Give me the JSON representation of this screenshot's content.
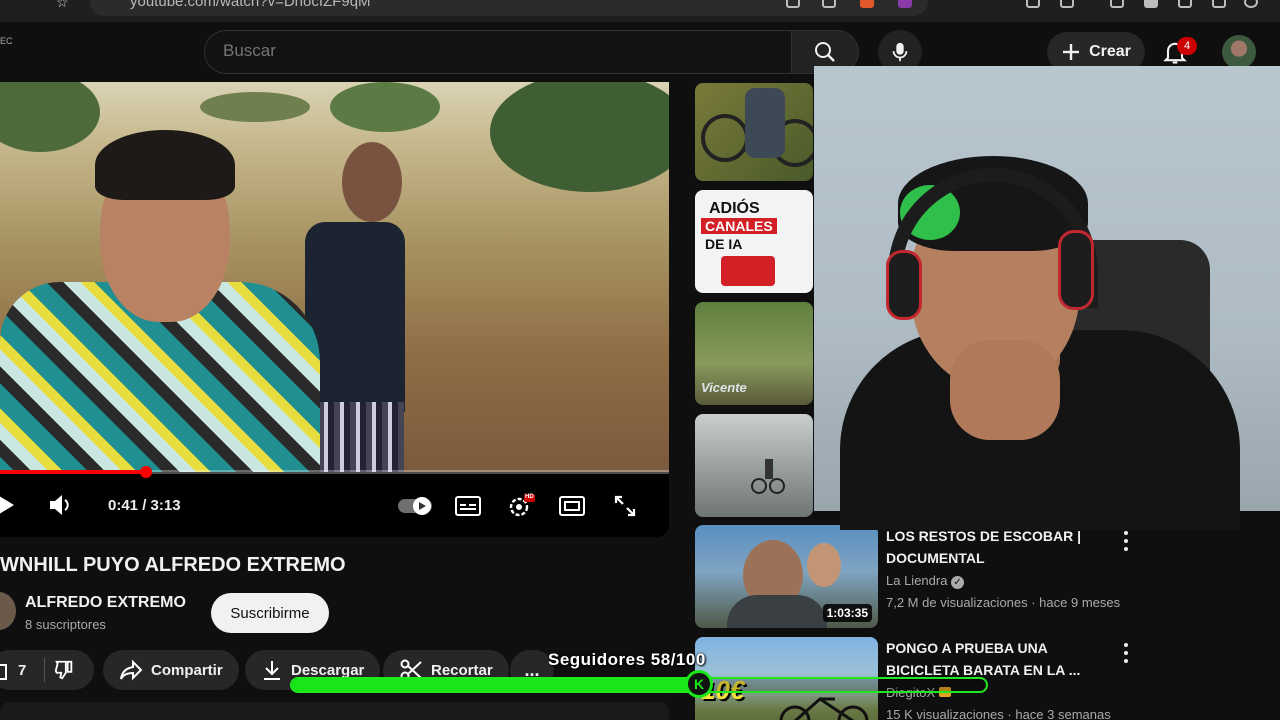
{
  "browser": {
    "url": "youtube.com/watch?v=DnocIZF9qM"
  },
  "header": {
    "country_code": "EC",
    "search_placeholder": "Buscar",
    "create_label": "Crear",
    "notifications_count": "4"
  },
  "player": {
    "time": "0:41 / 3:13",
    "progress": 0.218,
    "hd_badge": "HD"
  },
  "video": {
    "title": "WNHILL PUYO ALFREDO EXTREMO",
    "channel": "ALFREDO EXTREMO",
    "subscribers": "8 suscriptores",
    "subscribe_label": "Suscribirme",
    "likes": "7",
    "share_label": "Compartir",
    "download_label": "Descargar",
    "clip_label": "Recortar",
    "more_label": "..."
  },
  "sidebar": {
    "thumb2_lines": [
      "ADIÓS",
      "CANALES",
      "DE IA"
    ],
    "thumb3_caption": "Vicente",
    "recommendations": [
      {
        "title": "LOS RESTOS DE ESCOBAR | DOCUMENTAL",
        "channel": "La Liendra",
        "meta": "7,2 M de visualizaciones · hace 9 meses",
        "duration": "1:03:35"
      },
      {
        "title": "PONGO A PRUEBA UNA BICICLETA BARATA EN LA ...",
        "channel": "DiegitoX",
        "meta": "15 K visualizaciones · hace 3 semanas",
        "duration": "",
        "thumb_text": "10€"
      }
    ]
  },
  "overlay": {
    "followers_label": "Seguidores 58/100",
    "followers_progress": 0.58,
    "knob_letter": "K"
  }
}
